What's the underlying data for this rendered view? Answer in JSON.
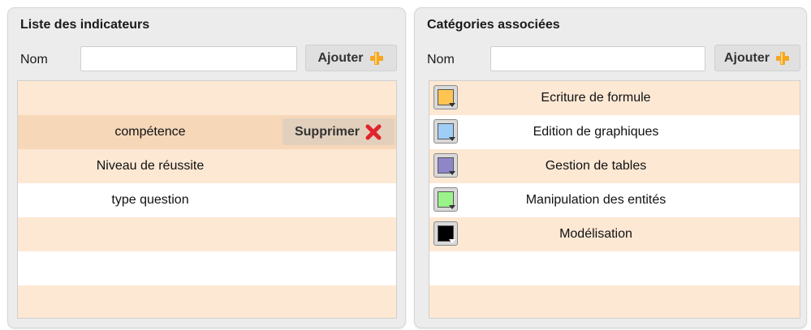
{
  "left_panel": {
    "title": "Liste des indicateurs",
    "name_label": "Nom",
    "name_value": "",
    "add_label": "Ajouter",
    "rows": [
      {
        "label": ""
      },
      {
        "label": "compétence",
        "delete_label": "Supprimer"
      },
      {
        "label": "Niveau de réussite"
      },
      {
        "label": "type question"
      },
      {
        "label": ""
      },
      {
        "label": ""
      },
      {
        "label": ""
      }
    ]
  },
  "right_panel": {
    "title": "Catégories associées",
    "name_label": "Nom",
    "name_value": "",
    "add_label": "Ajouter",
    "rows": [
      {
        "label": "Ecriture de formule",
        "color": "#ffc451"
      },
      {
        "label": "Edition de graphiques",
        "color": "#9ecdf6"
      },
      {
        "label": "Gestion de tables",
        "color": "#8f86c8"
      },
      {
        "label": "Manipulation des entités",
        "color": "#9af38a"
      },
      {
        "label": "Modélisation",
        "color": "#000000"
      },
      {
        "label": ""
      },
      {
        "label": ""
      }
    ]
  },
  "icons": {
    "add": "plus-icon",
    "delete": "x-icon"
  },
  "colors": {
    "row_orange": "#fde8d4",
    "row_highlight": "#f6d7b8",
    "plus_icon": "#f5a623",
    "x_icon": "#e0232d"
  }
}
